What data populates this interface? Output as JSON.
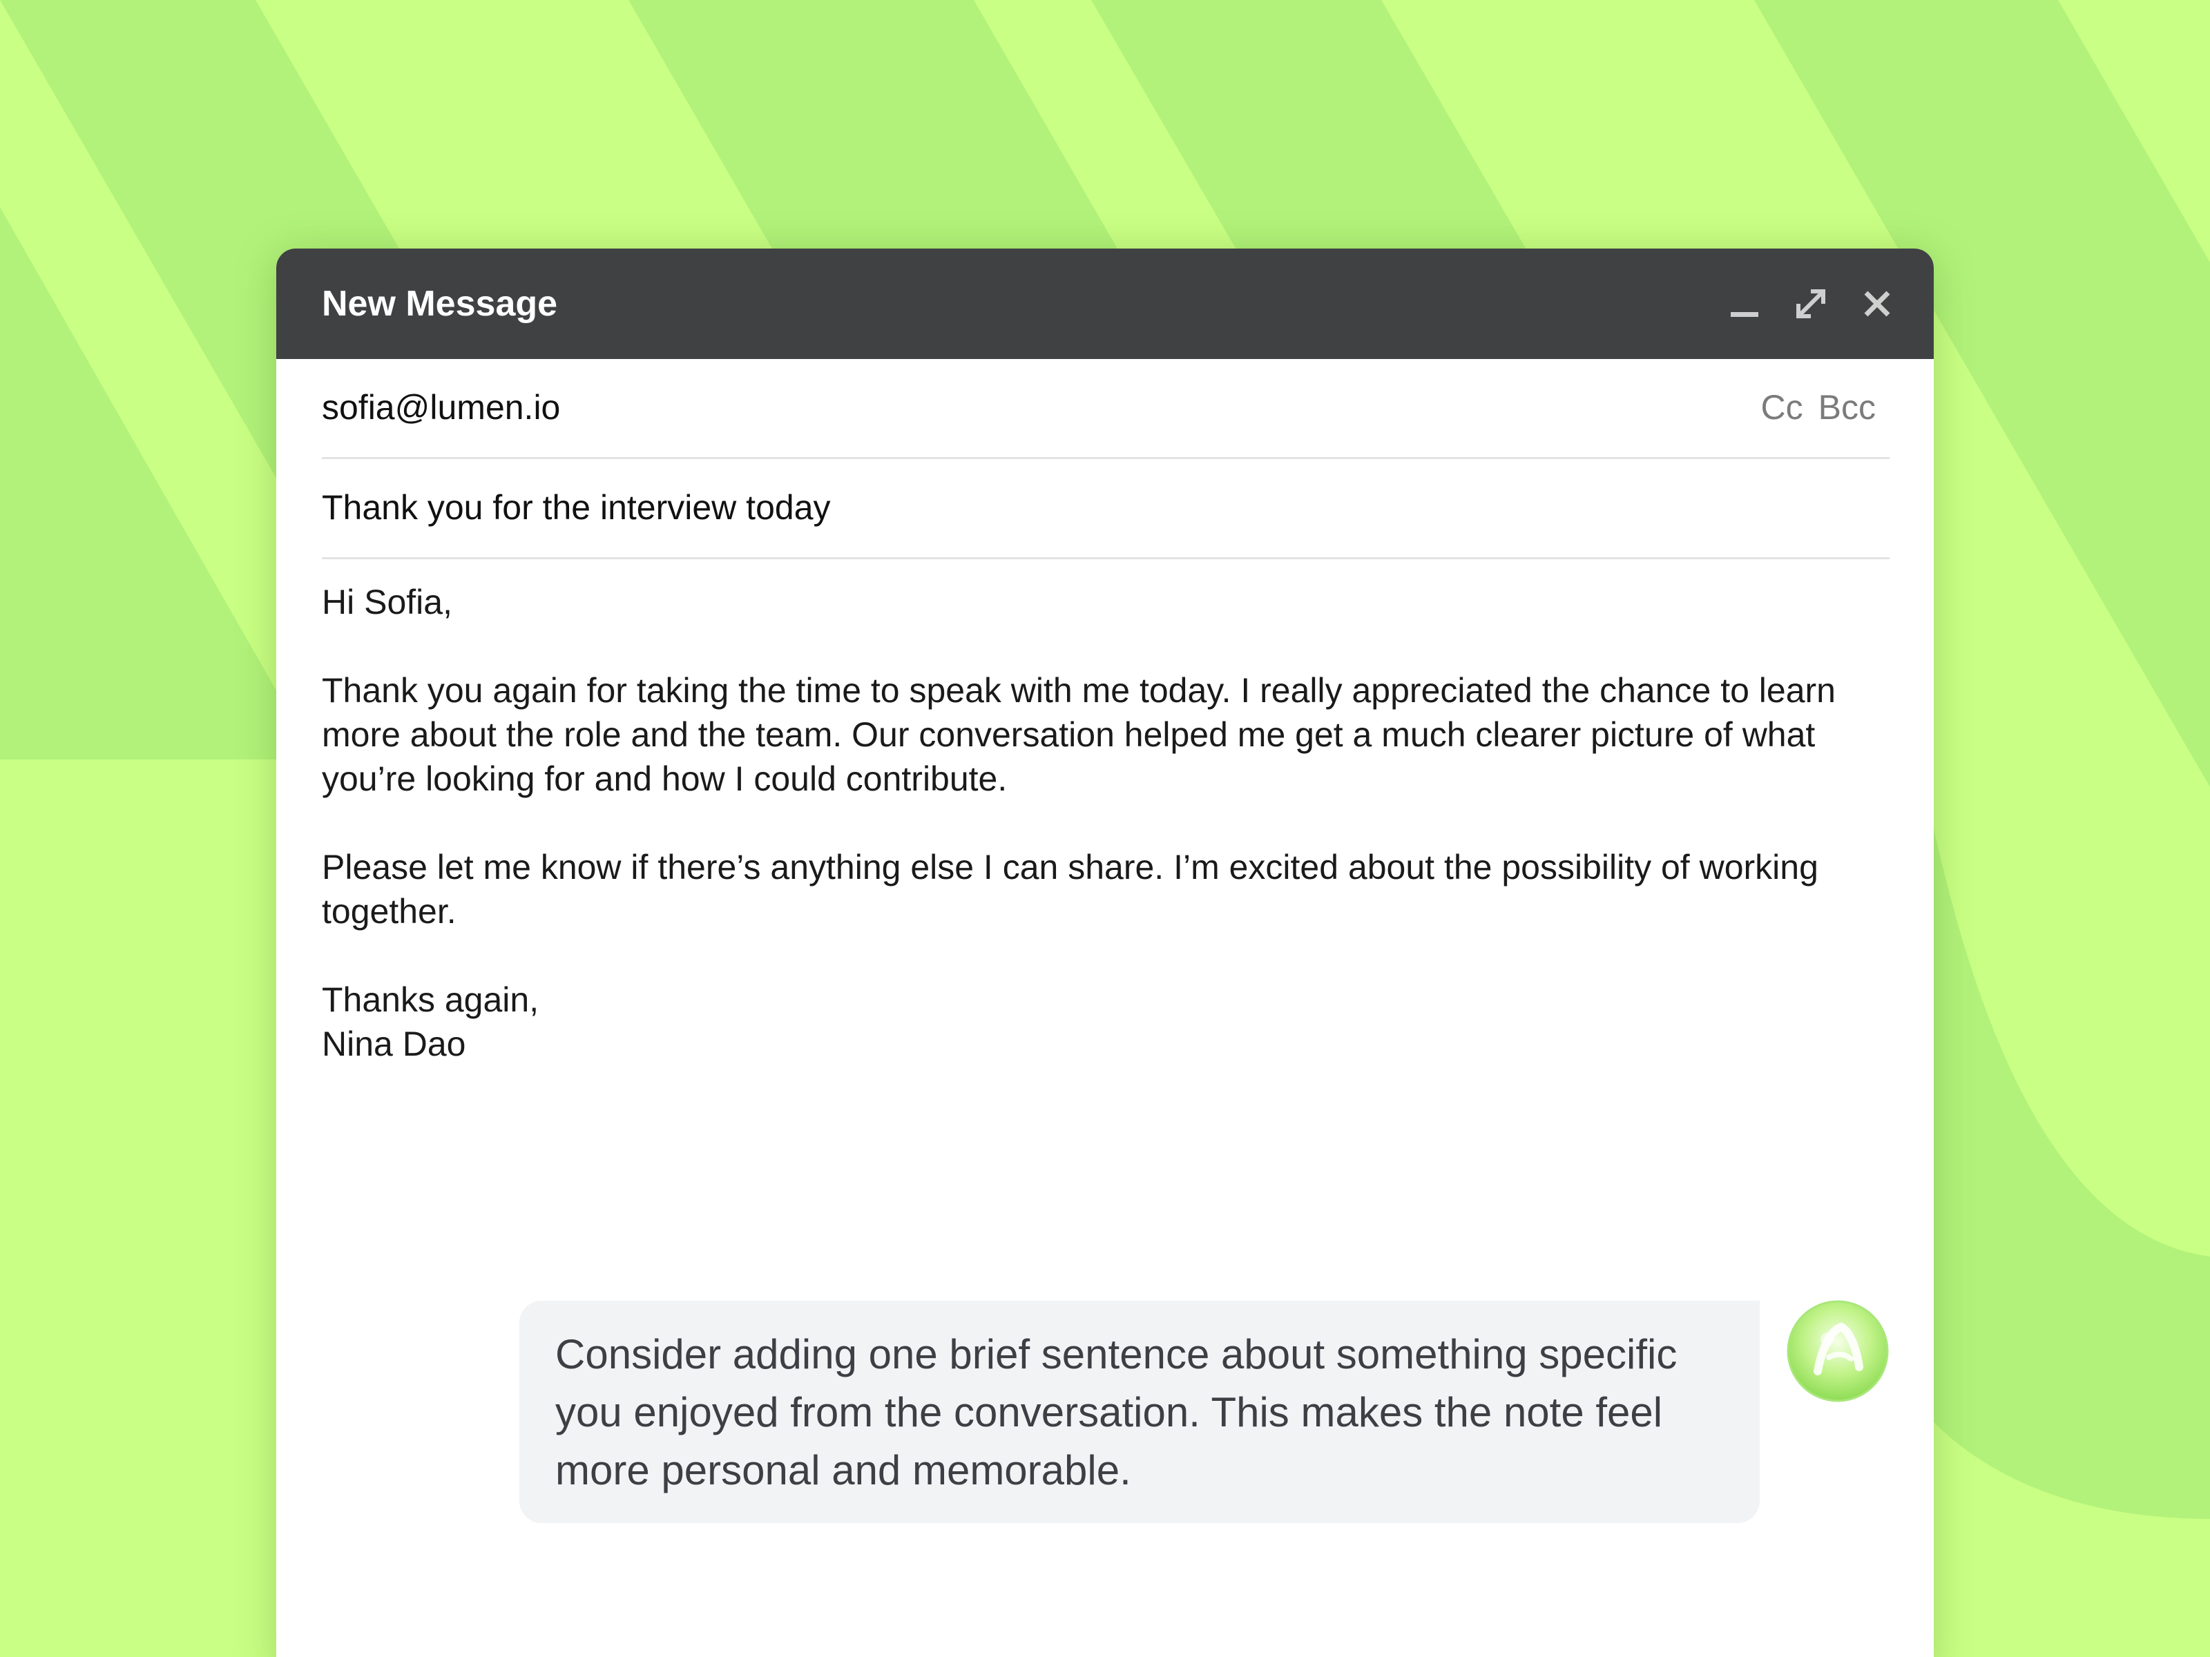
{
  "colors": {
    "background": "#c9ff84",
    "stripe": "#b2f27a",
    "titlebar": "#404143",
    "suggestion_bg": "#f2f3f5"
  },
  "window": {
    "title": "New Message",
    "controls": {
      "minimize_icon": "minimize-icon",
      "expand_icon": "expand-icon",
      "close_icon": "close-icon"
    }
  },
  "compose": {
    "to": "sofia@lumen.io",
    "cc_label": "Cc",
    "bcc_label": "Bcc",
    "subject": "Thank you for the interview today",
    "body": {
      "greeting": "Hi Sofia,",
      "paragraph1": "Thank you again for taking the time to speak with me today. I really appreciated the chance to learn more about the role and the team. Our conversation helped me get a much clearer picture of what you’re looking for and how I could contribute.",
      "paragraph2": "Please let me know if there’s anything else I can share. I’m excited about the possibility of working together.",
      "signoff": "Thanks again,",
      "signature": "Nina Dao"
    }
  },
  "assistant": {
    "suggestion": "Consider adding one brief sentence about something specific you enjoyed from the conversation. This makes the note feel more personal and memorable.",
    "avatar_icon": "assistant-avatar-icon"
  }
}
